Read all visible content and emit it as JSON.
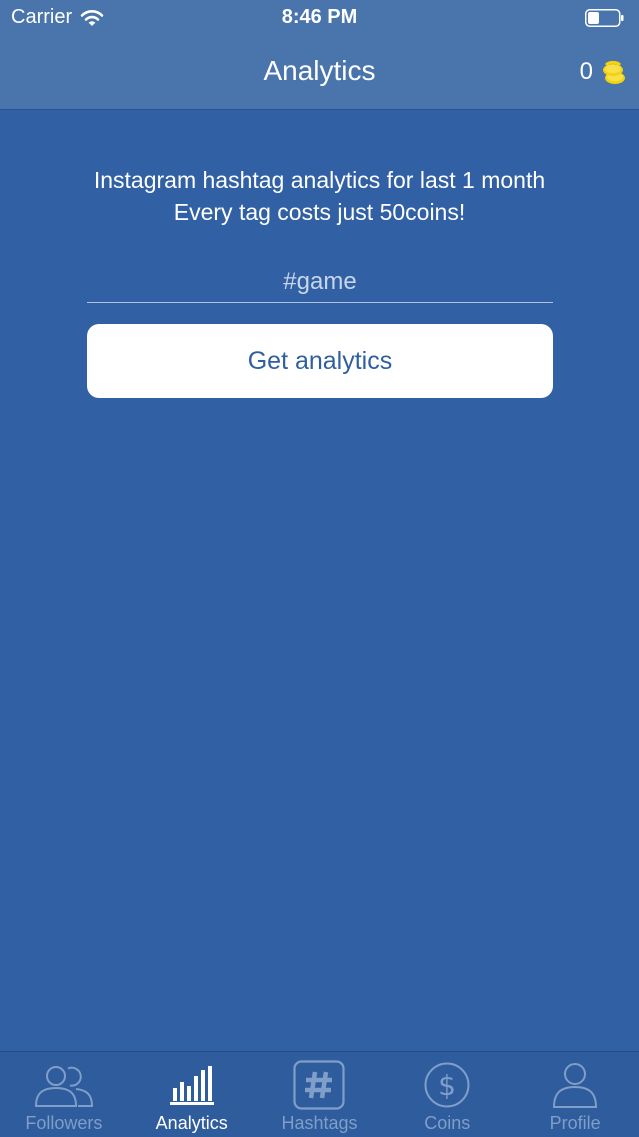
{
  "status_bar": {
    "carrier": "Carrier",
    "time": "8:46 PM",
    "icons": [
      "wifi-icon",
      "battery-icon"
    ]
  },
  "nav": {
    "title": "Analytics",
    "coin_count": "0",
    "coin_icon": "coins-icon"
  },
  "main": {
    "intro_line1": "Instagram hashtag analytics for last 1 month",
    "intro_line2": "Every tag costs just 50coins!",
    "hashtag_placeholder": "#game",
    "hashtag_value": "",
    "button_label": "Get analytics"
  },
  "tabs": [
    {
      "label": "Followers",
      "icon": "followers-icon",
      "active": false
    },
    {
      "label": "Analytics",
      "icon": "analytics-icon",
      "active": true
    },
    {
      "label": "Hashtags",
      "icon": "hashtag-icon",
      "active": false
    },
    {
      "label": "Coins",
      "icon": "dollar-coin-icon",
      "active": false
    },
    {
      "label": "Profile",
      "icon": "profile-icon",
      "active": false
    }
  ],
  "colors": {
    "background": "#3161a4",
    "nav_bar": "#4a74ac",
    "button_text": "#2f5f9f",
    "coin_gold": "#f5d20e",
    "tab_inactive": "#7f9ec9",
    "tab_active": "#ffffff"
  }
}
